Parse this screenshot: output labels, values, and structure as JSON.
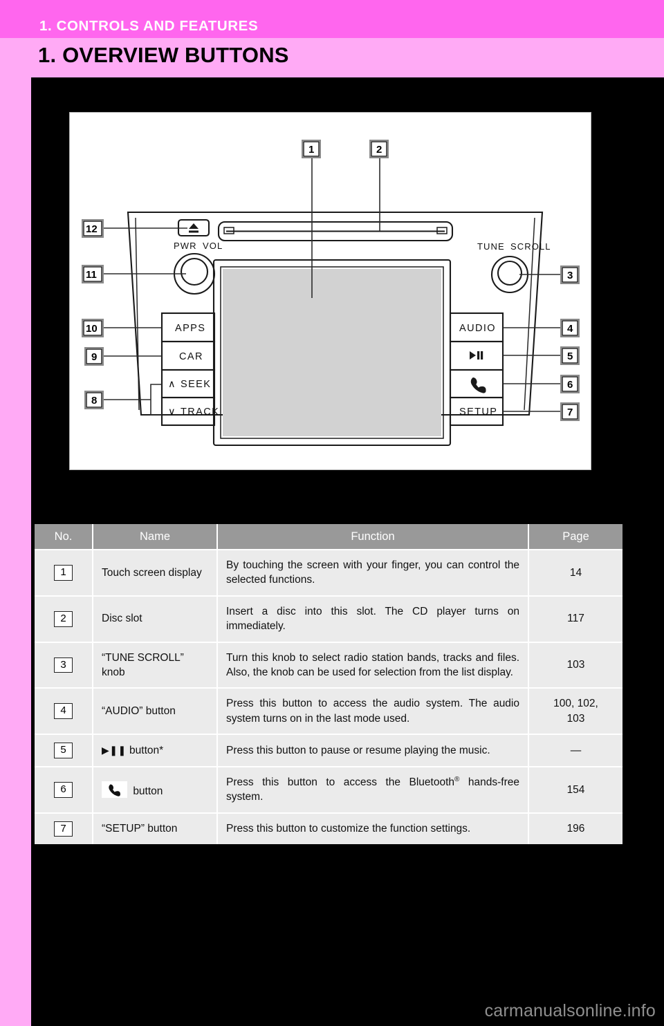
{
  "header": {
    "chapter": "1. CONTROLS AND FEATURES",
    "section": "1. OVERVIEW BUTTONS",
    "band_color": "#ff66ee",
    "page_color": "#ffaaf5"
  },
  "figure": {
    "name": "head-unit-front-panel-diagram",
    "device_labels": {
      "eject": "▲",
      "pwr": "PWR",
      "vol": "VOL",
      "tune": "TUNE",
      "scroll": "SCROLL",
      "apps": "APPS",
      "car": "CAR",
      "seek": "SEEK",
      "track": "TRACK",
      "audio": "AUDIO",
      "play_pause": "▶▐▐",
      "phone": "phone-icon",
      "setup": "SETUP",
      "seek_up_chevron": "∧",
      "track_down_chevron": "∨"
    },
    "callouts": [
      "1",
      "2",
      "3",
      "4",
      "5",
      "6",
      "7",
      "8",
      "9",
      "10",
      "11",
      "12"
    ]
  },
  "table": {
    "headers": {
      "no": "No.",
      "name": "Name",
      "function": "Function",
      "page": "Page"
    },
    "rows": [
      {
        "no": "1",
        "name": "Touch screen display",
        "name_kind": "text",
        "function": "By touching the screen with your finger, you can control the selected functions.",
        "page": "14"
      },
      {
        "no": "2",
        "name": "Disc slot",
        "name_kind": "text",
        "function": "Insert a disc into this slot. The CD player turns on immediately.",
        "page": "117"
      },
      {
        "no": "3",
        "name": "“TUNE SCROLL” knob",
        "name_kind": "text",
        "function": "Turn this knob to select radio station bands, tracks and files. Also, the knob can be used for selection from the list display.",
        "page": "103"
      },
      {
        "no": "4",
        "name": "“AUDIO” button",
        "name_kind": "text",
        "function": "Press this button to access the audio system. The audio system turns on in the last mode used.",
        "page": "100, 102,\n103"
      },
      {
        "no": "5",
        "name": "button*",
        "name_kind": "play-pause-icon",
        "function": "Press this button to pause or resume playing the music.",
        "page": "—"
      },
      {
        "no": "6",
        "name": "button",
        "name_kind": "phone-icon",
        "function_pre": "Press this button to access the Bluetooth",
        "function_sup": "®",
        "function_post": " hands-free system.",
        "page": "154"
      },
      {
        "no": "7",
        "name": "“SETUP” button",
        "name_kind": "text",
        "function": "Press this button to customize the function settings.",
        "page": "196"
      }
    ]
  },
  "watermark": {
    "text": "carmanualsonline.info"
  }
}
